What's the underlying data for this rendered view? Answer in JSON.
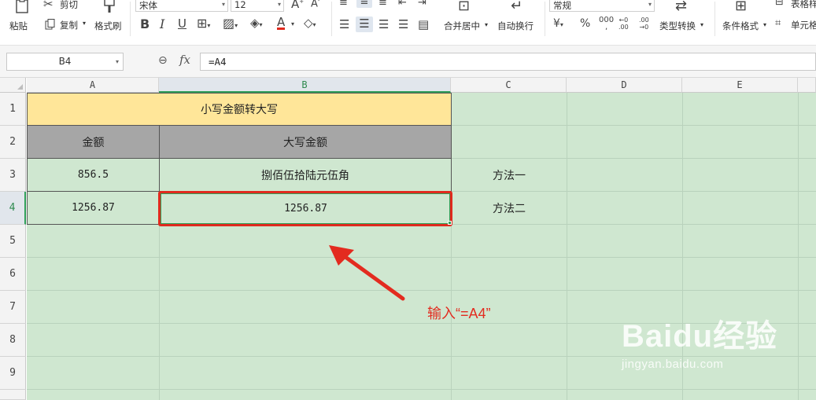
{
  "ribbon": {
    "paste_label": "粘贴",
    "cut_label": "剪切",
    "copy_label": "复制",
    "format_painter_label": "格式刷",
    "font_name": "宋体",
    "font_size": "12",
    "merge_center_label": "合并居中",
    "wrap_text_label": "自动换行",
    "number_format": "常规",
    "type_convert_label": "类型转换",
    "conditional_format_label": "条件格式",
    "table_style_label": "表格样",
    "cell_style_label": "单元格",
    "currency_symbol": "¥",
    "percent_symbol": "%"
  },
  "formula_bar": {
    "name_box": "B4",
    "fx_label": "fx",
    "formula": "=A4"
  },
  "columns": [
    "A",
    "B",
    "C",
    "D",
    "E"
  ],
  "rows": [
    "1",
    "2",
    "3",
    "4",
    "5",
    "6",
    "7",
    "8",
    "9"
  ],
  "active_cell": {
    "column": "B",
    "row": "4"
  },
  "cells": {
    "A1": "小写金额转大写",
    "A2": "金额",
    "B2": "大写金额",
    "A3": "856.5",
    "B3": "捌佰伍拾陆元伍角",
    "C3": "方法一",
    "A4": "1256.87",
    "B4": "1256.87",
    "C4": "方法二"
  },
  "annotation": "输入“=A4”",
  "watermark": {
    "logo": "Baidu经验",
    "url": "jingyan.baidu.com"
  },
  "colors": {
    "sheet_background": "#cfe7d0",
    "title_fill": "#ffe699",
    "header_fill": "#a6a6a6",
    "highlight": "#e02a1e",
    "selection": "#2f9e57"
  }
}
